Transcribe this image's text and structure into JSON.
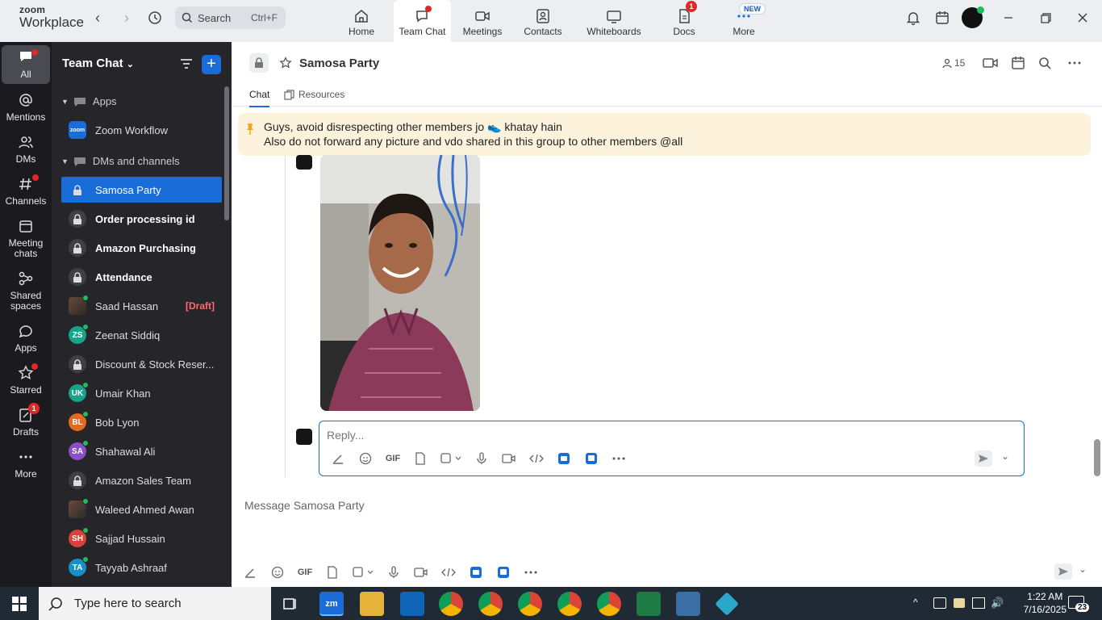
{
  "app": {
    "logo_line1": "zoom",
    "logo_line2": "Workplace"
  },
  "topbar": {
    "search_label": "Search",
    "search_shortcut": "Ctrl+F",
    "tabs": [
      {
        "label": "Home"
      },
      {
        "label": "Team Chat"
      },
      {
        "label": "Meetings"
      },
      {
        "label": "Contacts"
      },
      {
        "label": "Whiteboards"
      },
      {
        "label": "Docs",
        "badge": "1"
      },
      {
        "label": "More",
        "badge": "NEW"
      }
    ]
  },
  "rail": [
    {
      "label": "All"
    },
    {
      "label": "Mentions"
    },
    {
      "label": "DMs"
    },
    {
      "label": "Channels"
    },
    {
      "label": "Meeting chats"
    },
    {
      "label": "Shared spaces"
    },
    {
      "label": "Apps"
    },
    {
      "label": "Starred"
    },
    {
      "label": "Drafts",
      "badge": "1"
    },
    {
      "label": "More"
    }
  ],
  "sidebar": {
    "title": "Team Chat",
    "section_apps": "Apps",
    "zoom_workflow": "Zoom Workflow",
    "zoom_workflow_icon_text": "zoom",
    "section_dms": "DMs and channels",
    "items": [
      {
        "label": "Samosa Party",
        "type": "lock"
      },
      {
        "label": "Order processing id",
        "type": "lock"
      },
      {
        "label": "Amazon Purchasing",
        "type": "lock"
      },
      {
        "label": "Attendance",
        "type": "lock"
      },
      {
        "label": "Saad Hassan",
        "type": "photo",
        "draft": "[Draft]"
      },
      {
        "label": "Zeenat Siddiq",
        "initials": "ZS",
        "color": "#1aa38a"
      },
      {
        "label": "Discount & Stock Reser...",
        "type": "lock"
      },
      {
        "label": "Umair Khan",
        "initials": "UK",
        "color": "#1aa38a"
      },
      {
        "label": "Bob Lyon",
        "initials": "BL",
        "color": "#e06b1f"
      },
      {
        "label": "Shahawal Ali",
        "initials": "SA",
        "color": "#8a4fc7"
      },
      {
        "label": "Amazon Sales Team",
        "type": "lock"
      },
      {
        "label": "Waleed Ahmed Awan",
        "type": "photo"
      },
      {
        "label": "Sajjad Hussain",
        "initials": "SH",
        "color": "#d9413a"
      },
      {
        "label": "Tayyab Ashraaf",
        "initials": "TA",
        "color": "#1a8fc7"
      }
    ]
  },
  "channel": {
    "name": "Samosa Party",
    "member_count": "15",
    "subtabs": [
      "Chat",
      "Resources"
    ],
    "pinned_line1": "Guys, avoid disrespecting other members jo 👟 khatay hain",
    "pinned_line2": "Also do not forward any picture and vdo shared in this group to other members @all",
    "reply_placeholder": "Reply...",
    "message_placeholder": "Message Samosa Party",
    "gif_label": "GIF"
  },
  "taskbar": {
    "search_placeholder": "Type here to search",
    "time": "1:22 AM",
    "date": "7/16/2025",
    "notif_count": "23"
  },
  "colors": {
    "accent": "#1a6dd8",
    "sidebar_bg": "#26262a",
    "rail_bg": "#1b1b1f",
    "pin_bg": "#fdf3dd"
  }
}
